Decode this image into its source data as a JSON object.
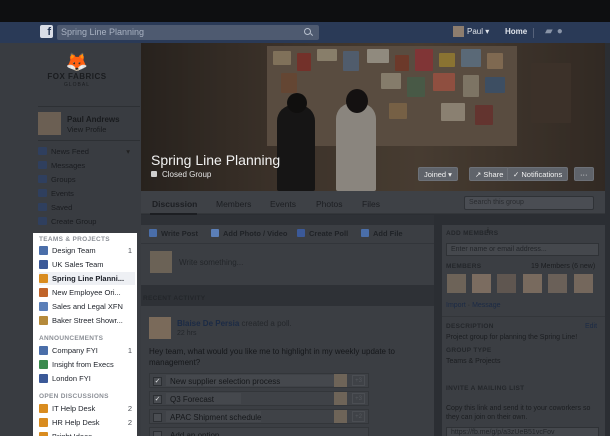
{
  "topbar": {
    "search_value": "Spring Line Planning",
    "user_name": "Paul",
    "home_label": "Home"
  },
  "company": {
    "logo_name": "FOX FABRICS",
    "logo_sub": "GLOBAL"
  },
  "profile": {
    "name": "Paul Andrews",
    "view": "View Profile"
  },
  "nav": [
    {
      "label": "News Feed",
      "icon": "news-feed-icon"
    },
    {
      "label": "Messages",
      "icon": "messages-icon"
    },
    {
      "label": "Groups",
      "icon": "groups-icon"
    },
    {
      "label": "Events",
      "icon": "events-icon"
    },
    {
      "label": "Saved",
      "icon": "saved-icon"
    },
    {
      "label": "Create Group",
      "icon": "create-group-icon"
    }
  ],
  "teams_projects": {
    "header": "TEAMS & PROJECTS",
    "items": [
      {
        "label": "Design Team",
        "count": "1",
        "color": "#4a6ea9"
      },
      {
        "label": "UK Sales Team",
        "count": "",
        "color": "#3b5998"
      },
      {
        "label": "Spring Line Planni...",
        "count": "",
        "color": "#d98c1f"
      },
      {
        "label": "New Employee Ori...",
        "count": "",
        "color": "#c0642a"
      },
      {
        "label": "Sales and Legal XFN",
        "count": "",
        "color": "#5b7fb8"
      },
      {
        "label": "Baker Street Showr...",
        "count": "",
        "color": "#b58a3b"
      }
    ]
  },
  "announcements": {
    "header": "ANNOUNCEMENTS",
    "items": [
      {
        "label": "Company FYI",
        "count": "1",
        "color": "#4a6ea9"
      },
      {
        "label": "Insight from Execs",
        "count": "",
        "color": "#3b8a4e"
      },
      {
        "label": "London FYI",
        "count": "",
        "color": "#3b5998"
      }
    ]
  },
  "open_discussions": {
    "header": "OPEN DISCUSSIONS",
    "items": [
      {
        "label": "IT Help Desk",
        "count": "2",
        "color": "#d98c1f"
      },
      {
        "label": "HR Help Desk",
        "count": "2",
        "color": "#d98c1f"
      },
      {
        "label": "Bright Ideas",
        "count": "",
        "color": "#d98c1f"
      }
    ]
  },
  "group": {
    "title": "Spring Line Planning",
    "privacy": "Closed Group",
    "joined": "Joined ▾",
    "share": "Share",
    "notifications": "Notifications",
    "more": "···"
  },
  "tabs": [
    "Discussion",
    "Members",
    "Events",
    "Photos",
    "Files"
  ],
  "group_search_placeholder": "Search this group",
  "composer": {
    "write_post": "Write Post",
    "add_photo": "Add Photo / Video",
    "create_poll": "Create Poll",
    "add_file": "Add File",
    "placeholder": "Write something..."
  },
  "recent_activity": "RECENT ACTIVITY",
  "post": {
    "author": "Blaise De Persia",
    "action": "created a poll.",
    "time": "22 hrs",
    "text": "Hey team, what would you like me to highlight in my weekly update to management?",
    "options": [
      {
        "label": "New supplier selection process",
        "checked": true,
        "votes": "+3"
      },
      {
        "label": "Q3 Forecast",
        "checked": true,
        "votes": "+3"
      },
      {
        "label": "APAC Shipment schedule",
        "checked": false,
        "votes": "+2"
      },
      {
        "label": "Add an option...",
        "checked": false,
        "votes": ""
      }
    ]
  },
  "right": {
    "add_members_header": "ADD MEMBERS",
    "add_members_placeholder": "Enter name or email address...",
    "members_header": "MEMBERS",
    "members_count": "19 Members (6 new)",
    "import_link": "Import",
    "message_link": "Message",
    "description_header": "DESCRIPTION",
    "edit_link": "Edit",
    "description_text": "Project group for planning the Spring Line!",
    "group_type_header": "GROUP TYPE",
    "group_type_value": "Teams & Projects",
    "mailing_header": "INVITE A MAILING LIST",
    "mailing_text": "Copy this link and send it to your coworkers so they can join on their own.",
    "mailing_link": "https://fb.me/g/p/a3zUeB51vcFov"
  },
  "colors": {
    "fb_blue": "#2a3a57",
    "link_blue": "#1b2a45"
  }
}
